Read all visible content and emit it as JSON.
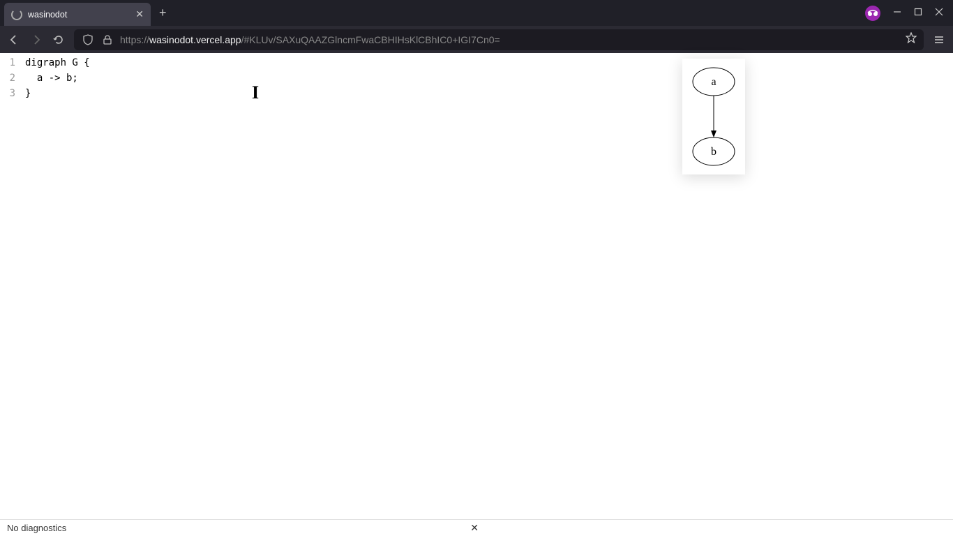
{
  "browser": {
    "tab_title": "wasinodot",
    "url_protocol": "https://",
    "url_domain": "wasinodot.vercel.app",
    "url_path": "/#KLUv/SAXuQAAZGlncmFwaCBHIHsKlCBhIC0+IGI7Cn0="
  },
  "editor": {
    "lines": [
      {
        "num": "1",
        "text": "digraph G {"
      },
      {
        "num": "2",
        "text": "  a -> b;"
      },
      {
        "num": "3",
        "text": "}"
      }
    ],
    "highlighted_line_index": 1
  },
  "graph": {
    "nodes": [
      {
        "id": "a",
        "label": "a"
      },
      {
        "id": "b",
        "label": "b"
      }
    ],
    "edges": [
      {
        "from": "a",
        "to": "b"
      }
    ]
  },
  "diagnostics": {
    "message": "No diagnostics"
  }
}
